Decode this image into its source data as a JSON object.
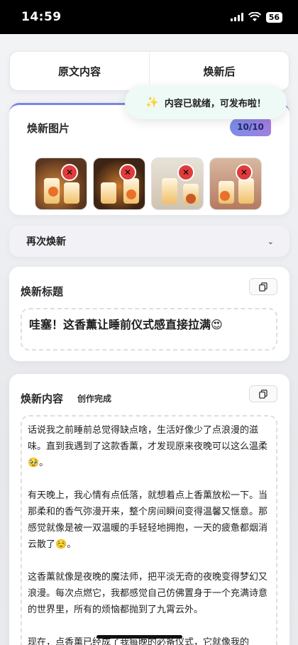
{
  "status_bar": {
    "time": "14:59",
    "battery": "56"
  },
  "tabs": [
    {
      "label": "原文内容"
    },
    {
      "label": "焕新后"
    }
  ],
  "toast": {
    "icon": "sparkle-icon",
    "text": "内容已就绪，可发布啦！"
  },
  "images_section": {
    "title": "焕新图片",
    "count": "10/10",
    "thumbnails": [
      {
        "name": "candle-product-photo-1"
      },
      {
        "name": "candle-product-photo-2"
      },
      {
        "name": "candle-product-photo-3"
      },
      {
        "name": "candle-product-photo-4"
      }
    ]
  },
  "regenerate": {
    "label": "再次焕新"
  },
  "title_section": {
    "label": "焕新标题",
    "text": "哇塞！这香薰让睡前仪式感直接拉满😍"
  },
  "content_section": {
    "label": "焕新内容",
    "status": "创作完成",
    "paragraphs": [
      "话说我之前睡前总觉得缺点啥，生活好像少了点浪漫的滋味。直到我遇到了这款香薰，才发现原来夜晚可以这么温柔🥹。",
      "有天晚上，我心情有点低落，就想着点上香薰放松一下。当那柔和的香气弥漫开来，整个房间瞬间变得温馨又惬意。那感觉就像是被一双温暖的手轻轻地拥抱，一天的疲惫都烟消云散了☺️。",
      "这香薰就像是夜晚的魔法师，把平淡无奇的夜晚变得梦幻又浪漫。每次点燃它，我都感觉自己仿佛置身于一个充满诗意的世界里，所有的烦恼都抛到了九霄云外。",
      "现在，点香薰已经成了我每晚的必备仪式，它就像我的"
    ]
  },
  "colors": {
    "badge_start": "#7b8de6",
    "badge_end": "#a47ee0",
    "delete": "#e03b3b",
    "toast_bg": "#eefaf6"
  }
}
